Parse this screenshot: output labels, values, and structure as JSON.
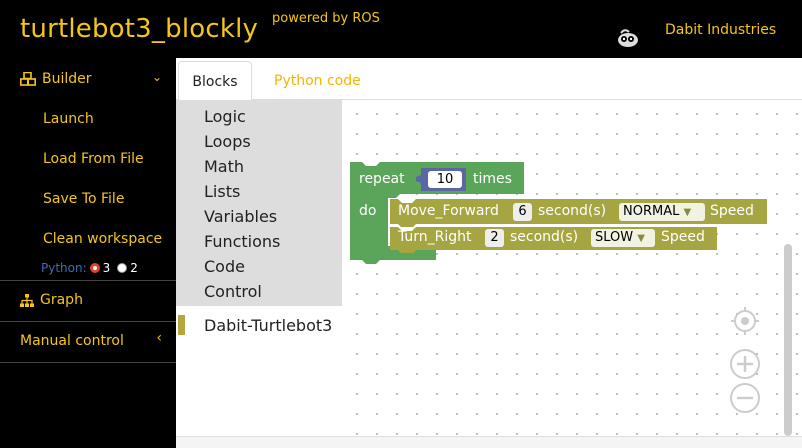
{
  "header": {
    "title": "turtlebot3_blockly",
    "powered_by": "powered by ROS",
    "company": "Dabit Industries"
  },
  "sidebar": {
    "builder_label": "Builder",
    "items": [
      "Launch",
      "Load From File",
      "Save To File",
      "Clean workspace"
    ],
    "python_label": "Python:",
    "python_options": [
      "3",
      "2"
    ],
    "python_selected": "3",
    "graph_label": "Graph",
    "manual_label": "Manual control"
  },
  "tabs": [
    "Blocks",
    "Python code"
  ],
  "active_tab": "Blocks",
  "toolbox": {
    "categories": [
      "Logic",
      "Loops",
      "Math",
      "Lists",
      "Variables",
      "Functions",
      "Code",
      "Control"
    ],
    "custom_category": "Dabit-Turtlebot3"
  },
  "blocks": {
    "repeat": {
      "label": "repeat",
      "count": "10",
      "times_label": "times",
      "do_label": "do"
    },
    "move_forward": {
      "name": "Move_Forward",
      "value": "6",
      "unit": "second(s)",
      "speed": "NORMAL",
      "speed_label": "Speed"
    },
    "turn_right": {
      "name": "Turn_Right",
      "value": "2",
      "unit": "second(s)",
      "speed": "SLOW",
      "speed_label": "Speed"
    }
  },
  "colors": {
    "header_bg": "#000000",
    "accent": "#f5c518",
    "loop_block": "#5ba55b",
    "robot_block": "#a5a542",
    "toolbox_bg": "#dddddd"
  }
}
